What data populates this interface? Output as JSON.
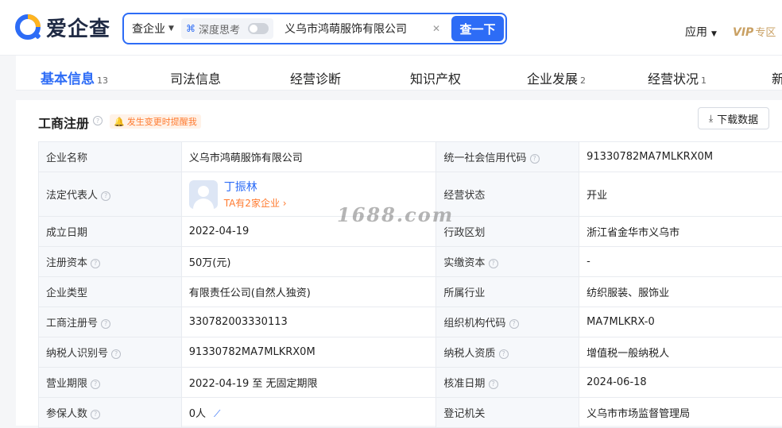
{
  "header": {
    "logo_text": "爱企查",
    "search_scope": "查企业",
    "deep_think_label": "深度思考",
    "query_value": "义乌市鸿萌服饰有限公司",
    "search_button": "查一下",
    "apps_label": "应用",
    "vip_label": "VIP",
    "vip_zone": "专区"
  },
  "tabs": [
    {
      "label": "基本信息",
      "count": "13",
      "active": true
    },
    {
      "label": "司法信息",
      "count": ""
    },
    {
      "label": "经营诊断",
      "count": ""
    },
    {
      "label": "知识产权",
      "count": ""
    },
    {
      "label": "企业发展",
      "count": "2"
    },
    {
      "label": "经营状况",
      "count": "1"
    },
    {
      "label": "新",
      "count": ""
    }
  ],
  "section": {
    "title": "工商注册",
    "change_alert": "发生变更时提醒我",
    "download_label": "下载数据"
  },
  "registration": {
    "rows": [
      [
        {
          "label": "企业名称",
          "help": false
        },
        {
          "value": "义乌市鸿萌服饰有限公司"
        },
        {
          "label": "统一社会信用代码",
          "help": true
        },
        {
          "value": "91330782MA7MLKRX0M"
        }
      ],
      [
        {
          "label": "法定代表人",
          "help": true
        },
        {
          "rep_name": "丁振林",
          "rep_sub": "TA有2家企业"
        },
        {
          "label": "经营状态",
          "help": false
        },
        {
          "value": "开业"
        }
      ],
      [
        {
          "label": "成立日期",
          "help": false
        },
        {
          "value": "2022-04-19"
        },
        {
          "label": "行政区划",
          "help": false
        },
        {
          "value": "浙江省金华市义乌市"
        }
      ],
      [
        {
          "label": "注册资本",
          "help": true
        },
        {
          "value": "50万(元)"
        },
        {
          "label": "实缴资本",
          "help": true
        },
        {
          "value": "-"
        }
      ],
      [
        {
          "label": "企业类型",
          "help": false
        },
        {
          "value": "有限责任公司(自然人独资)"
        },
        {
          "label": "所属行业",
          "help": false
        },
        {
          "value": "纺织服装、服饰业"
        }
      ],
      [
        {
          "label": "工商注册号",
          "help": true
        },
        {
          "value": "330782003330113"
        },
        {
          "label": "组织机构代码",
          "help": true
        },
        {
          "value": "MA7MLKRX-0"
        }
      ],
      [
        {
          "label": "纳税人识别号",
          "help": true
        },
        {
          "value": "91330782MA7MLKRX0M"
        },
        {
          "label": "纳税人资质",
          "help": true
        },
        {
          "value": "增值税一般纳税人"
        }
      ],
      [
        {
          "label": "营业期限",
          "help": true
        },
        {
          "value": "2022-04-19 至 无固定期限"
        },
        {
          "label": "核准日期",
          "help": true
        },
        {
          "value": "2024-06-18"
        }
      ],
      [
        {
          "label": "参保人数",
          "help": true
        },
        {
          "value": "0人"
        },
        {
          "label": "登记机关",
          "help": false
        },
        {
          "value": "义乌市市场监督管理局"
        }
      ]
    ]
  },
  "watermark": "1688.com",
  "colors": {
    "accent": "#2d6cf6",
    "alert": "#ff7a2f",
    "vip": "#c9a063"
  }
}
